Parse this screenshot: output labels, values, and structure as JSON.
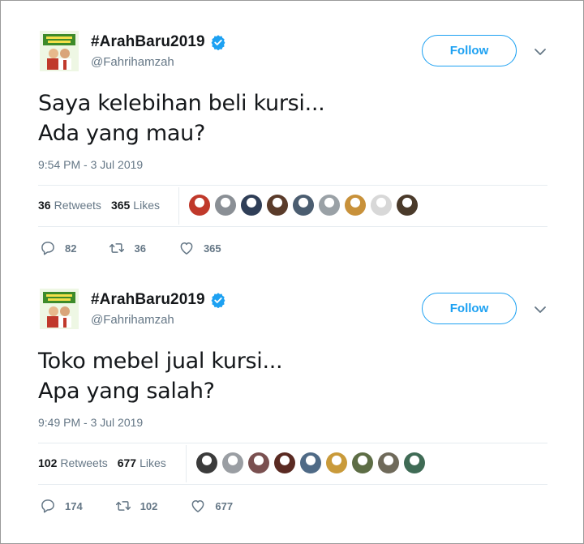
{
  "tweets": [
    {
      "display_name": "#ArahBaru2019",
      "handle": "@Fahrihamzah",
      "follow_label": "Follow",
      "text_lines": [
        "Saya kelebihan beli kursi...",
        "Ada yang mau?"
      ],
      "timestamp": "9:54 PM - 3 Jul 2019",
      "retweets_count": "36",
      "retweets_label": "Retweets",
      "likes_count": "365",
      "likes_label": "Likes",
      "replies": "82",
      "retweets": "36",
      "likes": "365",
      "liker_colors": [
        "#c0392b",
        "#8a8f95",
        "#2f3e57",
        "#5a3b2a",
        "#4b5d70",
        "#9aa1a6",
        "#c8913a",
        "#d8d8d8",
        "#4a3a2a"
      ]
    },
    {
      "display_name": "#ArahBaru2019",
      "handle": "@Fahrihamzah",
      "follow_label": "Follow",
      "text_lines": [
        "Toko mebel jual kursi...",
        "Apa yang salah?"
      ],
      "timestamp": "9:49 PM - 3 Jul 2019",
      "retweets_count": "102",
      "retweets_label": "Retweets",
      "likes_count": "677",
      "likes_label": "Likes",
      "replies": "174",
      "retweets": "102",
      "likes": "677",
      "liker_colors": [
        "#3b3b3b",
        "#9a9ea3",
        "#7a5050",
        "#5a2a22",
        "#4f6a86",
        "#c99a3a",
        "#5d6d45",
        "#6f6a5a",
        "#3f6b55"
      ]
    }
  ],
  "colors": {
    "accent": "#1da1f2",
    "text_primary": "#14171a",
    "text_secondary": "#657786",
    "divider": "#e6ecf0"
  },
  "icons": {
    "verified": "verified-badge-icon",
    "chevron": "chevron-down-icon",
    "reply": "reply-icon",
    "retweet": "retweet-icon",
    "like": "heart-icon"
  }
}
